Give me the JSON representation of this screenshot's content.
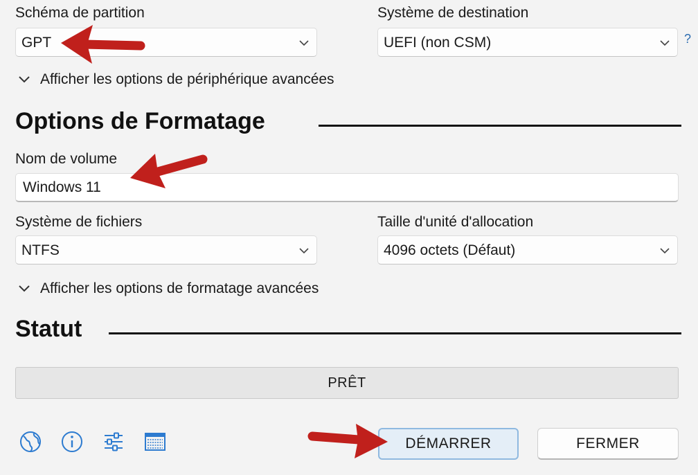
{
  "partition": {
    "label": "Schéma de partition",
    "value": "GPT"
  },
  "target": {
    "label": "Système de destination",
    "value": "UEFI (non CSM)",
    "help": "?"
  },
  "device_advanced_toggle": "Afficher les options de périphérique avancées",
  "format_section_title": "Options de Formatage",
  "volume": {
    "label": "Nom de volume",
    "value": "Windows 11"
  },
  "filesystem": {
    "label": "Système de fichiers",
    "value": "NTFS"
  },
  "cluster": {
    "label": "Taille d'unité d'allocation",
    "value": "4096 octets (Défaut)"
  },
  "format_advanced_toggle": "Afficher les options de formatage avancées",
  "status_section_title": "Statut",
  "status_text": "PRÊT",
  "buttons": {
    "start": "DÉMARRER",
    "close": "FERMER"
  },
  "toolbar_icons": [
    "globe-icon",
    "info-icon",
    "settings-sliders-icon",
    "log-table-icon"
  ],
  "colors": {
    "accent_border": "#8fb9e0",
    "primary_bg": "#e4eef7",
    "annotation_arrow": "#c0201c"
  }
}
